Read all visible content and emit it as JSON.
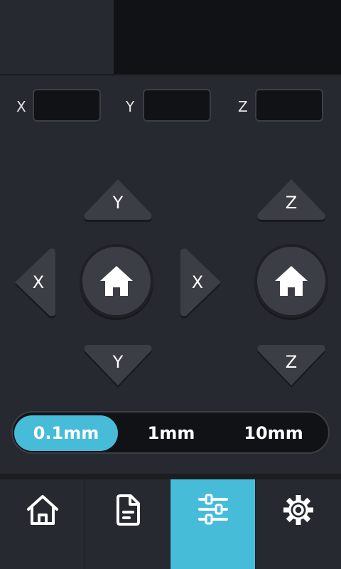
{
  "coordinates": {
    "x": {
      "label": "X",
      "value": ""
    },
    "y": {
      "label": "Y",
      "value": ""
    },
    "z": {
      "label": "Z",
      "value": ""
    }
  },
  "jog": {
    "y_plus": "Y",
    "y_minus": "Y",
    "x_minus": "X",
    "x_plus": "X",
    "z_plus": "Z",
    "z_minus": "Z",
    "icons": {
      "home_xy": "home-icon",
      "home_z": "home-icon"
    }
  },
  "step_sizes": {
    "options": [
      "0.1mm",
      "1mm",
      "10mm"
    ],
    "selected": "0.1mm"
  },
  "colors": {
    "accent": "#46bcd9",
    "background": "#26292f",
    "field": "#111216",
    "button": "#3b3e44"
  },
  "bottom_nav": {
    "items": [
      {
        "icon": "home-icon",
        "active": false
      },
      {
        "icon": "file-icon",
        "active": false
      },
      {
        "icon": "sliders-icon",
        "active": true
      },
      {
        "icon": "gear-icon",
        "active": false
      }
    ]
  }
}
